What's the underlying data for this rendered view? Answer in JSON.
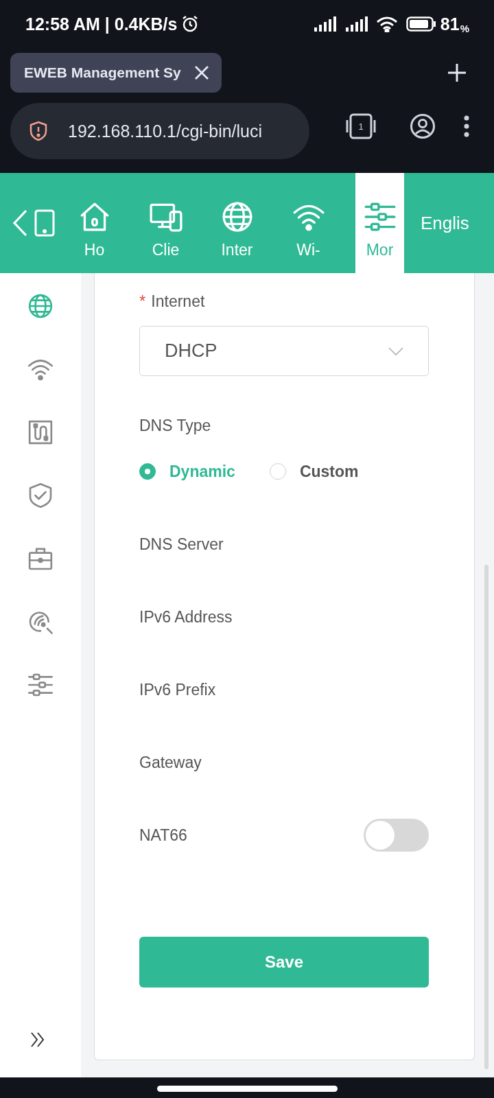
{
  "status_bar": {
    "time": "12:58 AM | 0.4KB/s",
    "battery": "81",
    "battery_unit": "%"
  },
  "browser": {
    "tab_title": "EWEB Management Sy",
    "url": "192.168.110.1/cgi-bin/luci",
    "tab_count": "1"
  },
  "top_nav": {
    "items": [
      {
        "kind": "home",
        "label": "Ho",
        "selected": false
      },
      {
        "kind": "devices",
        "label": "Clie",
        "selected": false
      },
      {
        "kind": "globe",
        "label": "Inter",
        "selected": false
      },
      {
        "kind": "wifi",
        "label": "Wi-",
        "selected": false
      },
      {
        "kind": "sliders",
        "label": "Mor",
        "selected": true
      }
    ],
    "language": "Englis"
  },
  "sidebar": {
    "items": [
      {
        "kind": "globe",
        "selected": true
      },
      {
        "kind": "wifi",
        "selected": false
      },
      {
        "kind": "port",
        "selected": false
      },
      {
        "kind": "shield",
        "selected": false
      },
      {
        "kind": "toolbox",
        "selected": false
      },
      {
        "kind": "scan",
        "selected": false
      },
      {
        "kind": "sliders",
        "selected": false
      }
    ]
  },
  "form": {
    "internet": {
      "label": "Internet",
      "required": true,
      "required_mark": "*",
      "value": "DHCP"
    },
    "dns_type": {
      "label": "DNS Type",
      "options": [
        {
          "label": "Dynamic",
          "selected": true
        },
        {
          "label": "Custom",
          "selected": false
        }
      ]
    },
    "fields": [
      "DNS Server",
      "IPv6 Address",
      "IPv6 Prefix",
      "Gateway"
    ],
    "nat66": {
      "label": "NAT66",
      "on": false
    },
    "save": "Save"
  }
}
